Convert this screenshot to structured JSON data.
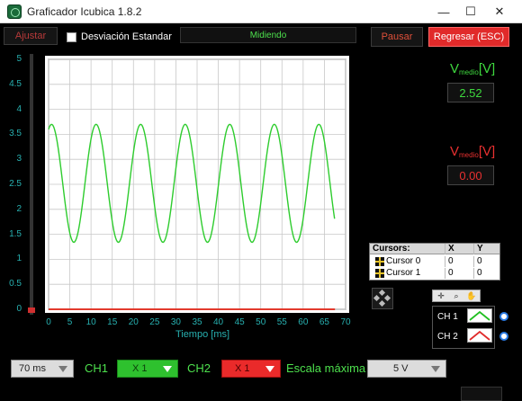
{
  "window": {
    "title": "Graficador Icubica 1.8.2",
    "minimize": "—",
    "maximize": "☐",
    "close": "✕"
  },
  "toolbar": {
    "ajustar": "Ajustar",
    "std_dev_label": "Desviación Estandar",
    "std_dev_checked": false,
    "status": "Midiendo",
    "pausar": "Pausar",
    "regresar": "Regresar (ESC)"
  },
  "meters": {
    "ch1_label_v": "V",
    "ch1_label_sub": "medio",
    "ch1_label_unit": "[V]",
    "ch1_value": "2.52",
    "ch2_label_v": "V",
    "ch2_label_sub": "medio",
    "ch2_label_unit": "[V]",
    "ch2_value": "0.00"
  },
  "cursors": {
    "headers": [
      "Cursors:",
      "X",
      "Y"
    ],
    "rows": [
      {
        "name": "Cursor 0",
        "x": "0",
        "y": "0"
      },
      {
        "name": "Cursor 1",
        "x": "0",
        "y": "0"
      }
    ]
  },
  "channels": [
    {
      "label": "CH 1",
      "color": "#1fbf1f"
    },
    {
      "label": "CH 2",
      "color": "#e02a2a"
    }
  ],
  "bottom": {
    "time_value": "70 ms",
    "ch1_label": "CH1",
    "ch1_value": "X 1",
    "ch2_label": "CH2",
    "ch2_value": "X 1",
    "scale_label": "Escala máxima",
    "scale_value": "5 V"
  },
  "chart_data": {
    "type": "line",
    "xlabel": "Tiempo [ms]",
    "ylabel": "",
    "xlim": [
      0,
      70
    ],
    "ylim": [
      0,
      5
    ],
    "xticks": [
      0,
      5,
      10,
      15,
      20,
      25,
      30,
      35,
      40,
      45,
      50,
      55,
      60,
      65,
      70
    ],
    "yticks": [
      0,
      0.5,
      1,
      1.5,
      2,
      2.5,
      3,
      3.5,
      4,
      4.5,
      5
    ],
    "grid": true,
    "series": [
      {
        "color": "#2ecc2e",
        "kind": "sine",
        "offset": 2.52,
        "amplitude": 1.18,
        "period_ms": 10.5,
        "phase_ms": 0.7,
        "x_start": 0,
        "x_end": 67.5
      },
      {
        "color": "#e33b2e",
        "kind": "constant",
        "value": 0.0,
        "x_start": 0,
        "x_end": 67.5
      }
    ]
  }
}
